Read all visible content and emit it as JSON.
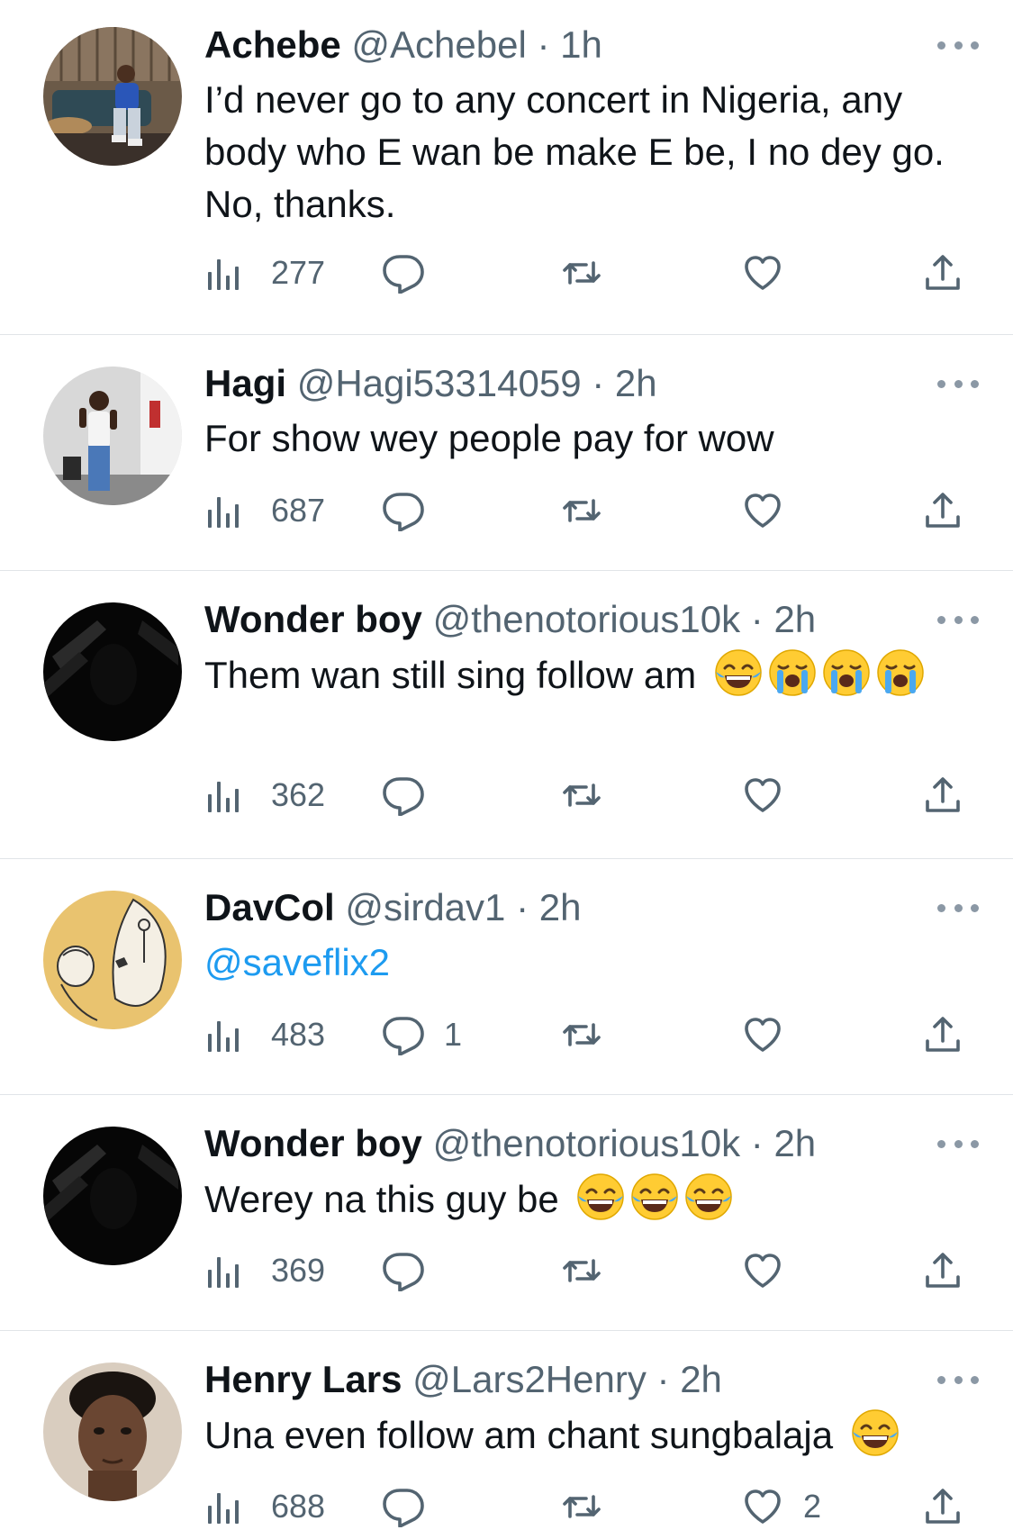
{
  "tweets": [
    {
      "name": "Achebe",
      "handle": "@Achebel",
      "dot": "·",
      "time": "1h",
      "text": "I’d never go to any concert in Nigeria, any body who E wan be make E be, I no dey go. No, thanks.",
      "views": "277",
      "replies": "",
      "likes": "",
      "avatar": "man-on-couch-photo"
    },
    {
      "name": "Hagi",
      "handle": "@Hagi53314059",
      "dot": "·",
      "time": "2h",
      "text": "For show wey people pay for wow",
      "views": "687",
      "replies": "",
      "likes": "",
      "avatar": "man-standing-photo"
    },
    {
      "name": "Wonder boy",
      "handle": "@thenotorious10k",
      "dot": "·",
      "time": "2h",
      "text": "Them wan still sing follow am",
      "emojis": [
        "laughing-crying-emoji",
        "loudly-crying-emoji",
        "loudly-crying-emoji",
        "loudly-crying-emoji"
      ],
      "views": "362",
      "replies": "",
      "likes": "",
      "avatar": "dark-hooded-figure"
    },
    {
      "name": "DavCol",
      "handle": "@sirdav1",
      "dot": "·",
      "time": "2h",
      "text": "@saveflix2",
      "views": "483",
      "replies": "1",
      "likes": "",
      "avatar": "cartoon-faces-illustration"
    },
    {
      "name": "Wonder boy",
      "handle": "@thenotorious10k",
      "dot": "·",
      "time": "2h",
      "text": "Werey na this guy be",
      "emojis": [
        "laughing-crying-emoji",
        "laughing-crying-emoji",
        "laughing-crying-emoji"
      ],
      "views": "369",
      "replies": "",
      "likes": "",
      "avatar": "dark-hooded-figure"
    },
    {
      "name": "Henry Lars",
      "handle": "@Lars2Henry",
      "dot": "·",
      "time": "2h",
      "text": "Una even follow am chant sungbalaja",
      "emojis": [
        "laughing-crying-emoji"
      ],
      "views": "688",
      "replies": "",
      "likes": "2",
      "avatar": "man-portrait-photo"
    }
  ],
  "colors": {
    "text": "#0f1419",
    "secondary": "#536471",
    "link": "#1d9bf0",
    "divider": "#e1e4e8"
  }
}
